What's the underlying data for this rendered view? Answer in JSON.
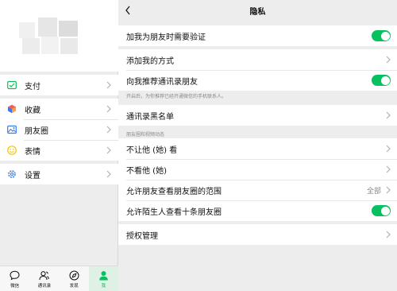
{
  "left": {
    "menu": [
      {
        "label": "支付",
        "icon": "payment-icon",
        "color": "#07c160"
      },
      {
        "label": "收藏",
        "icon": "favorites-icon",
        "color": "#fa9d3b"
      },
      {
        "label": "朋友圈",
        "icon": "moments-icon",
        "color": "#3d7be0"
      },
      {
        "label": "表情",
        "icon": "sticker-icon",
        "color": "#f7c300"
      },
      {
        "label": "设置",
        "icon": "settings-icon",
        "color": "#3d7be0"
      }
    ],
    "tabs": [
      {
        "label": "微信",
        "icon": "chat-icon"
      },
      {
        "label": "通讯录",
        "icon": "contacts-icon"
      },
      {
        "label": "发现",
        "icon": "discover-icon"
      },
      {
        "label": "我",
        "icon": "me-icon",
        "active": true
      }
    ]
  },
  "privacy": {
    "title": "隐私",
    "rows": {
      "verify": "加我为朋友时需要验证",
      "add_methods": "添加我的方式",
      "recommend": "向我推荐通讯录朋友",
      "recommend_note": "开启后，为你推荐已经开通微信的手机联系人。",
      "blacklist": "通讯录黑名单",
      "section_label": "朋友圈和视频动态",
      "hide_from": "不让他 (她) 看",
      "hide_them": "不看他 (她)",
      "moments_range": "允许朋友查看朋友圈的范围",
      "moments_range_value": "全部",
      "strangers": "允许陌生人查看十条朋友圈",
      "authorization": "授权管理"
    },
    "toggles": {
      "verify": true,
      "recommend": true,
      "strangers": true
    }
  },
  "colors": {
    "accent": "#07c160",
    "background": "#ededed"
  }
}
